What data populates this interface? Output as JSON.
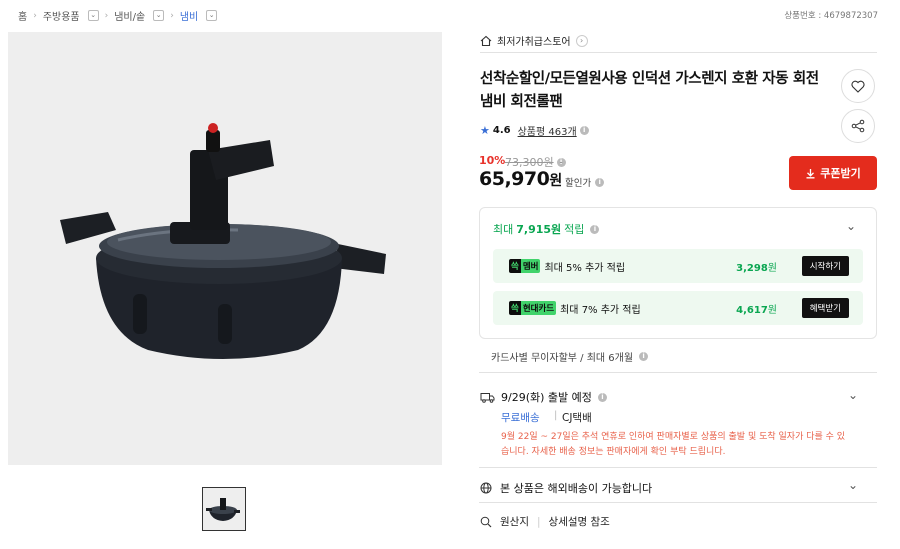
{
  "breadcrumb": {
    "items": [
      "홈",
      "주방용품",
      "냄비/솥",
      "냄비"
    ]
  },
  "product_no_label": "상품번호 : 4679872307",
  "store": {
    "name": "최저가취급스토어"
  },
  "product": {
    "title": "선착순할인/모든열원사용 인덕션 가스렌지 호환 자동 회전냄비 회전롤팬",
    "rating": "4.6",
    "review_label": "상품평 463개",
    "discount": "10%",
    "original_price": "73,300원",
    "price": "65,970",
    "price_unit": "원",
    "price_label": "할인가"
  },
  "buttons": {
    "coupon": "쿠폰받기"
  },
  "points": {
    "title_prefix": "최대 ",
    "title_amount": "7,915원",
    "title_suffix": " 적립",
    "rows": [
      {
        "badge_k": "쓱",
        "badge_name": "멤버",
        "desc": "최대 5% 추가 적립",
        "amount": "3,298",
        "unit": "원",
        "button": "시작하기"
      },
      {
        "badge_k": "쓱",
        "badge_name": "현대카드",
        "desc": "최대 7% 추가 적립",
        "amount": "4,617",
        "unit": "원",
        "button": "혜택받기"
      }
    ]
  },
  "card_installment": "카드사별 무이자할부 / 최대 6개월",
  "shipping": {
    "date": "9/29(화) 출발 예정",
    "free": "무료배송",
    "carrier": "CJ택배",
    "notice": "9월 22일 ~ 27일은 추석 연휴로 인하여 판매자별로 상품의 출발 및 도착 일자가 다를 수 있습니다. 자세한 배송 정보는 판매자에게 확인 부탁 드립니다."
  },
  "overseas": "본 상품은 해외배송이 가능합니다",
  "origin": {
    "label": "원산지",
    "value": "상세설명 참조"
  },
  "colors": {
    "accent_red": "#e42c1d",
    "point_green": "#0aa651",
    "link_blue": "#3a6fd6"
  }
}
